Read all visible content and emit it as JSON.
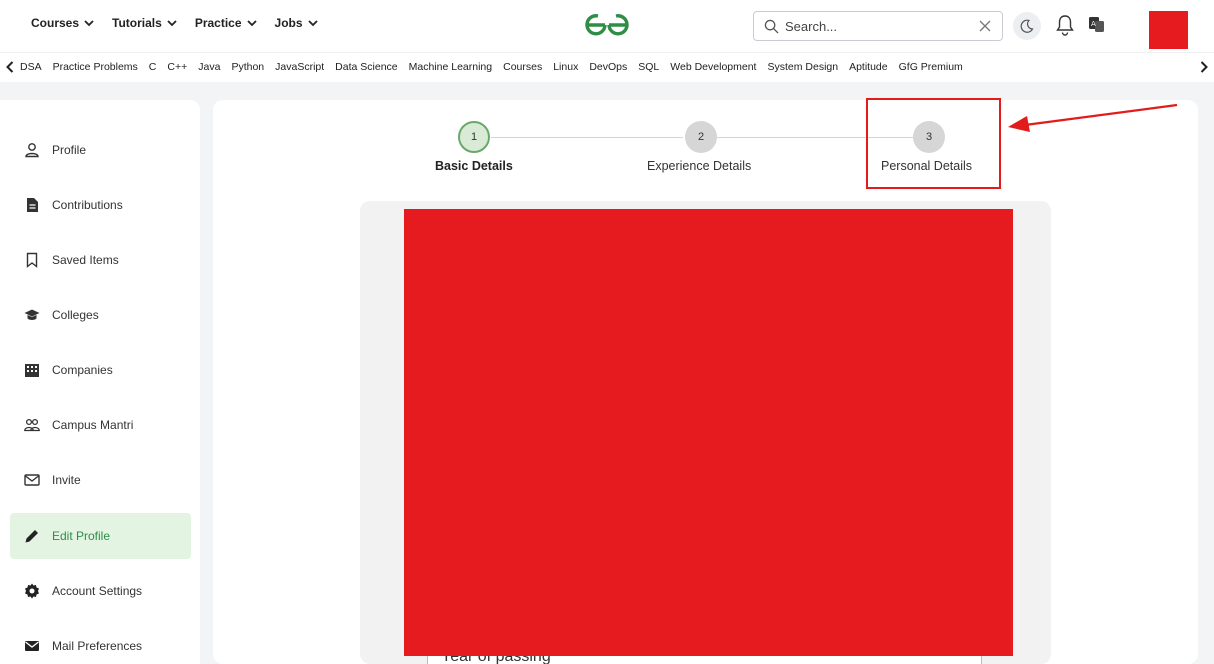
{
  "header": {
    "nav": [
      {
        "label": "Courses"
      },
      {
        "label": "Tutorials"
      },
      {
        "label": "Practice"
      },
      {
        "label": "Jobs"
      }
    ],
    "search": {
      "placeholder": "Search..."
    },
    "logo_icon": "gfg-logo-icon",
    "colors": {
      "brand": "#2f8d46",
      "redaction": "#e51b1f",
      "annotation": "#e31b1b"
    }
  },
  "subnav": {
    "links": [
      "DSA",
      "Practice Problems",
      "C",
      "C++",
      "Java",
      "Python",
      "JavaScript",
      "Data Science",
      "Machine Learning",
      "Courses",
      "Linux",
      "DevOps",
      "SQL",
      "Web Development",
      "System Design",
      "Aptitude",
      "GfG Premium"
    ]
  },
  "sidebar": {
    "items": [
      {
        "label": "Profile",
        "icon": "user-icon"
      },
      {
        "label": "Contributions",
        "icon": "document-icon"
      },
      {
        "label": "Saved Items",
        "icon": "bookmark-icon"
      },
      {
        "label": "Colleges",
        "icon": "graduation-cap-icon"
      },
      {
        "label": "Companies",
        "icon": "building-icon"
      },
      {
        "label": "Campus Mantri",
        "icon": "users-icon"
      },
      {
        "label": "Invite",
        "icon": "mail-outline-icon"
      },
      {
        "label": "Edit Profile",
        "icon": "pencil-icon",
        "active": true
      },
      {
        "label": "Account Settings",
        "icon": "gear-icon"
      },
      {
        "label": "Mail Preferences",
        "icon": "mail-icon"
      }
    ]
  },
  "stepper": {
    "steps": [
      {
        "number": "1",
        "label": "Basic Details",
        "active": true
      },
      {
        "number": "2",
        "label": "Experience Details"
      },
      {
        "number": "3",
        "label": "Personal Details"
      }
    ]
  },
  "form": {
    "field_label": "Year of passing"
  }
}
